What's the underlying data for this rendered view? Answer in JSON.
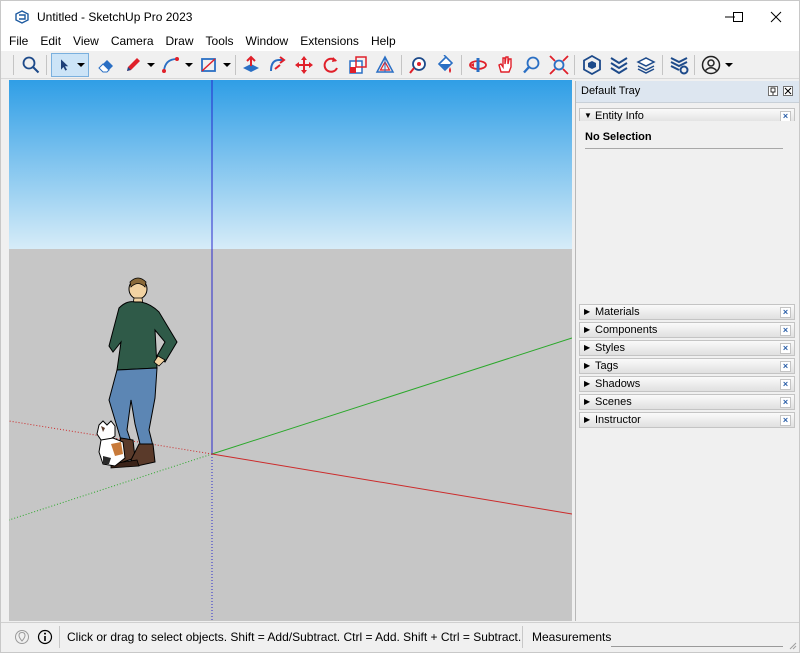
{
  "window": {
    "title": "Untitled - SketchUp Pro 2023",
    "app_icon": "sketchup-logo-icon",
    "controls": [
      "minimize-icon",
      "maximize-icon",
      "close-icon"
    ]
  },
  "menu": {
    "items": [
      "File",
      "Edit",
      "View",
      "Camera",
      "Draw",
      "Tools",
      "Window",
      "Extensions",
      "Help"
    ]
  },
  "toolbar": {
    "tools": [
      {
        "name": "search",
        "icon": "search-icon"
      },
      {
        "name": "select",
        "icon": "select-arrow-icon",
        "active": true
      },
      {
        "name": "eraser",
        "icon": "eraser-icon"
      },
      {
        "name": "line",
        "icon": "pencil-icon"
      },
      {
        "name": "arc",
        "icon": "arc-icon"
      },
      {
        "name": "rectangle",
        "icon": "rectangle-icon"
      },
      {
        "name": "push-pull",
        "icon": "push-pull-icon"
      },
      {
        "name": "follow-me",
        "icon": "follow-me-icon"
      },
      {
        "name": "move",
        "icon": "move-icon"
      },
      {
        "name": "rotate",
        "icon": "rotate-icon"
      },
      {
        "name": "scale",
        "icon": "scale-icon"
      },
      {
        "name": "offset",
        "icon": "offset-icon"
      },
      {
        "name": "tape-measure",
        "icon": "tape-measure-icon"
      },
      {
        "name": "paint-bucket",
        "icon": "paint-bucket-icon"
      },
      {
        "name": "orbit",
        "icon": "orbit-icon"
      },
      {
        "name": "pan",
        "icon": "pan-hand-icon"
      },
      {
        "name": "zoom",
        "icon": "zoom-icon"
      },
      {
        "name": "zoom-extents",
        "icon": "zoom-extents-icon"
      },
      {
        "name": "3d-warehouse",
        "icon": "warehouse-icon"
      },
      {
        "name": "extension-warehouse",
        "icon": "extension-warehouse-icon"
      },
      {
        "name": "layout",
        "icon": "layout-icon"
      },
      {
        "name": "extension-manager",
        "icon": "extension-manager-icon"
      },
      {
        "name": "account",
        "icon": "account-icon"
      }
    ],
    "colors": {
      "red": "#e0202a",
      "blue": "#2a6fc4",
      "navy": "#1d4a8a"
    }
  },
  "viewport": {
    "colors": {
      "sky_top": "#2f9ee6",
      "sky_bottom": "#d6ecf8",
      "ground": "#c6c6c6",
      "axis_red": "#cc2a2a",
      "axis_green": "#2aa82a",
      "axis_blue": "#2a2acc"
    }
  },
  "tray": {
    "title": "Default Tray",
    "entity_info": {
      "label": "Entity Info",
      "selection": "No Selection"
    },
    "panels": [
      "Materials",
      "Components",
      "Styles",
      "Tags",
      "Shadows",
      "Scenes",
      "Instructor"
    ],
    "close_glyph": "×"
  },
  "status": {
    "message": "Click or drag to select objects. Shift = Add/Subtract. Ctrl = Add. Shift + Ctrl = Subtract.",
    "measurements_label": "Measurements",
    "measurements_value": "",
    "icons": [
      "geo-location-icon",
      "info-icon"
    ]
  }
}
